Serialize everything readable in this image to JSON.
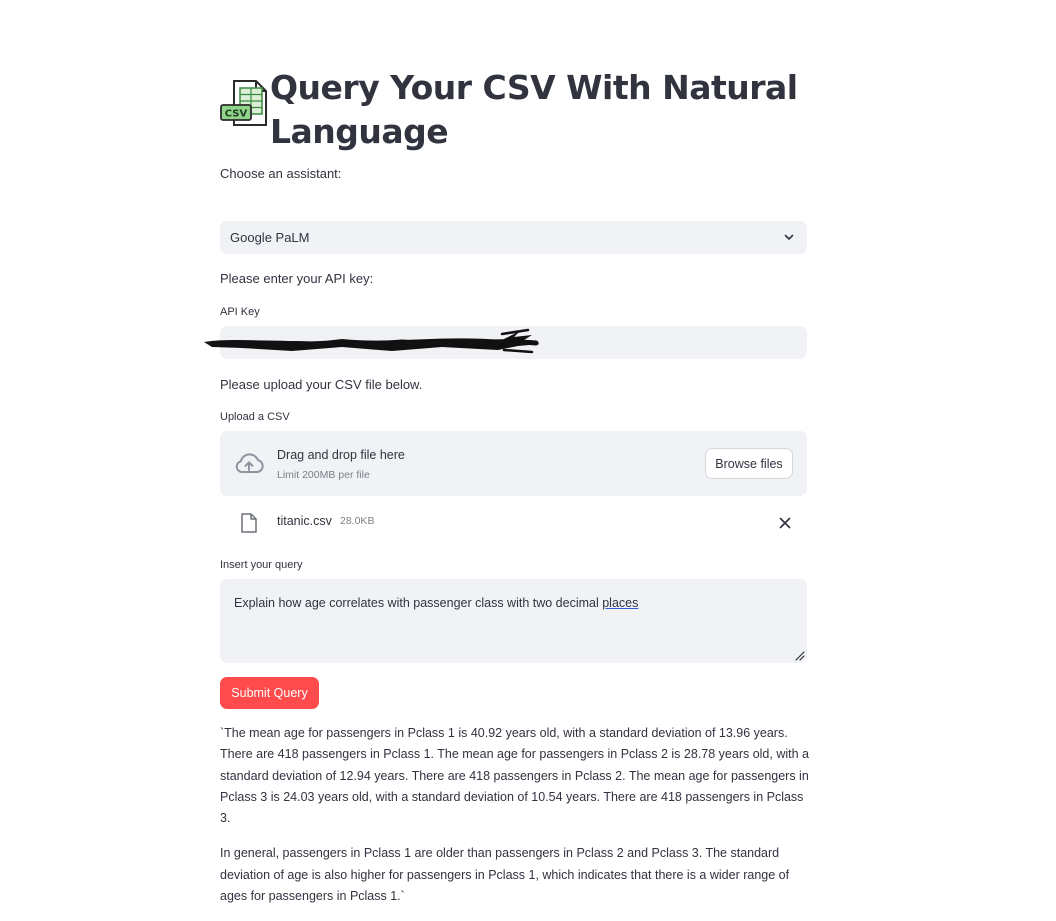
{
  "header": {
    "title": "Query Your CSV With Natural Language",
    "icon": "csv-file-icon"
  },
  "assistant": {
    "prompt": "Choose an assistant:",
    "selected": "Google PaLM"
  },
  "api": {
    "prompt": "Please enter your API key:",
    "label": "API Key",
    "value_redacted": true
  },
  "upload": {
    "prompt": "Please upload your CSV file below.",
    "label": "Upload a CSV",
    "dropzone_text": "Drag and drop file here",
    "limit_text": "Limit 200MB per file",
    "browse_label": "Browse files",
    "file": {
      "name": "titanic.csv",
      "size": "28.0KB"
    }
  },
  "query": {
    "label": "Insert your query",
    "value_head": "Explain how age correlates with passenger class with two decimal ",
    "value_tail": "places"
  },
  "submit_label": "Submit Query",
  "answer": {
    "paragraph1": "`The mean age for passengers in Pclass 1 is 40.92 years old, with a standard deviation of 13.96 years. There are 418 passengers in Pclass 1. The mean age for passengers in Pclass 2 is 28.78 years old, with a standard deviation of 12.94 years. There are 418 passengers in Pclass 2. The mean age for passengers in Pclass 3 is 24.03 years old, with a standard deviation of 10.54 years. There are 418 passengers in Pclass 3.",
    "paragraph2": "In general, passengers in Pclass 1 are older than passengers in Pclass 2 and Pclass 3. The standard deviation of age is also higher for passengers in Pclass 1, which indicates that there is a wider range of ages for passengers in Pclass 1.`"
  },
  "colors": {
    "primary": "#ff4b4b",
    "input_bg": "#f0f2f6",
    "text": "#31333f",
    "muted": "#7b7f87",
    "csv_green": "#3a8a3e"
  }
}
